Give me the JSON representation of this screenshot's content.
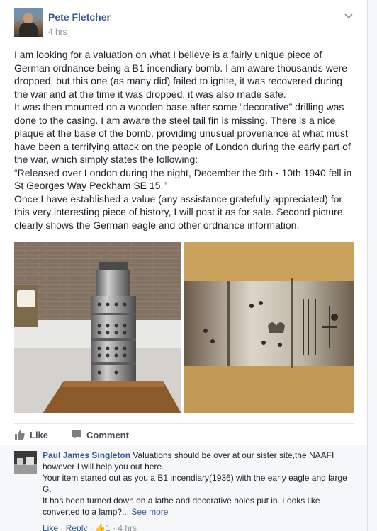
{
  "post": {
    "author": "Pete Fletcher",
    "time": "4 hrs",
    "paragraphs": [
      "I am looking for a valuation on what I believe is a fairly unique piece of German ordnance being a B1 incendiary bomb. I am aware thousands were dropped, but this one (as many did) failed to ignite, it was recovered during the war and at the time it was dropped, it was also made safe.",
      "It was then mounted on a wooden base after some “decorative” drilling was done to the casing. I am aware the steel tail fin is missing. There is a nice plaque at the base of the bomb, providing unusual provenance at what must have been a terrifying attack on the people of London during the early part of the war, which simply states the following:",
      "“Released over London during the night, December the 9th - 10th 1940 fell in St Georges Way Peckham SE 15.”",
      "Once I have established a value (any assistance gratefully appreciated) for this very interesting piece of history, I will post it as for sale. Second picture clearly shows the German eagle and other ordnance information."
    ]
  },
  "actions": {
    "like": "Like",
    "comment": "Comment"
  },
  "comment": {
    "author": "Paul James Singleton",
    "lines": [
      "Valuations should be over at our sister site,the NAAFI however I will help you out here.",
      "Your item started out as you a B1 incendiary(1936) with the early eagle and large G.",
      "It has been turned down on a lathe and decorative holes put in. Looks like converted to a lamp?...",
      "See more"
    ],
    "meta": {
      "like": "Like",
      "reply": "Reply",
      "reactions": "1",
      "time": "4 hrs"
    }
  },
  "icons": {
    "menu": "chevron-down-icon",
    "like": "thumbs-up-icon",
    "comment": "speech-bubble-icon"
  },
  "colors": {
    "link": "#365899",
    "meta": "#90949c",
    "text": "#1d2129"
  }
}
